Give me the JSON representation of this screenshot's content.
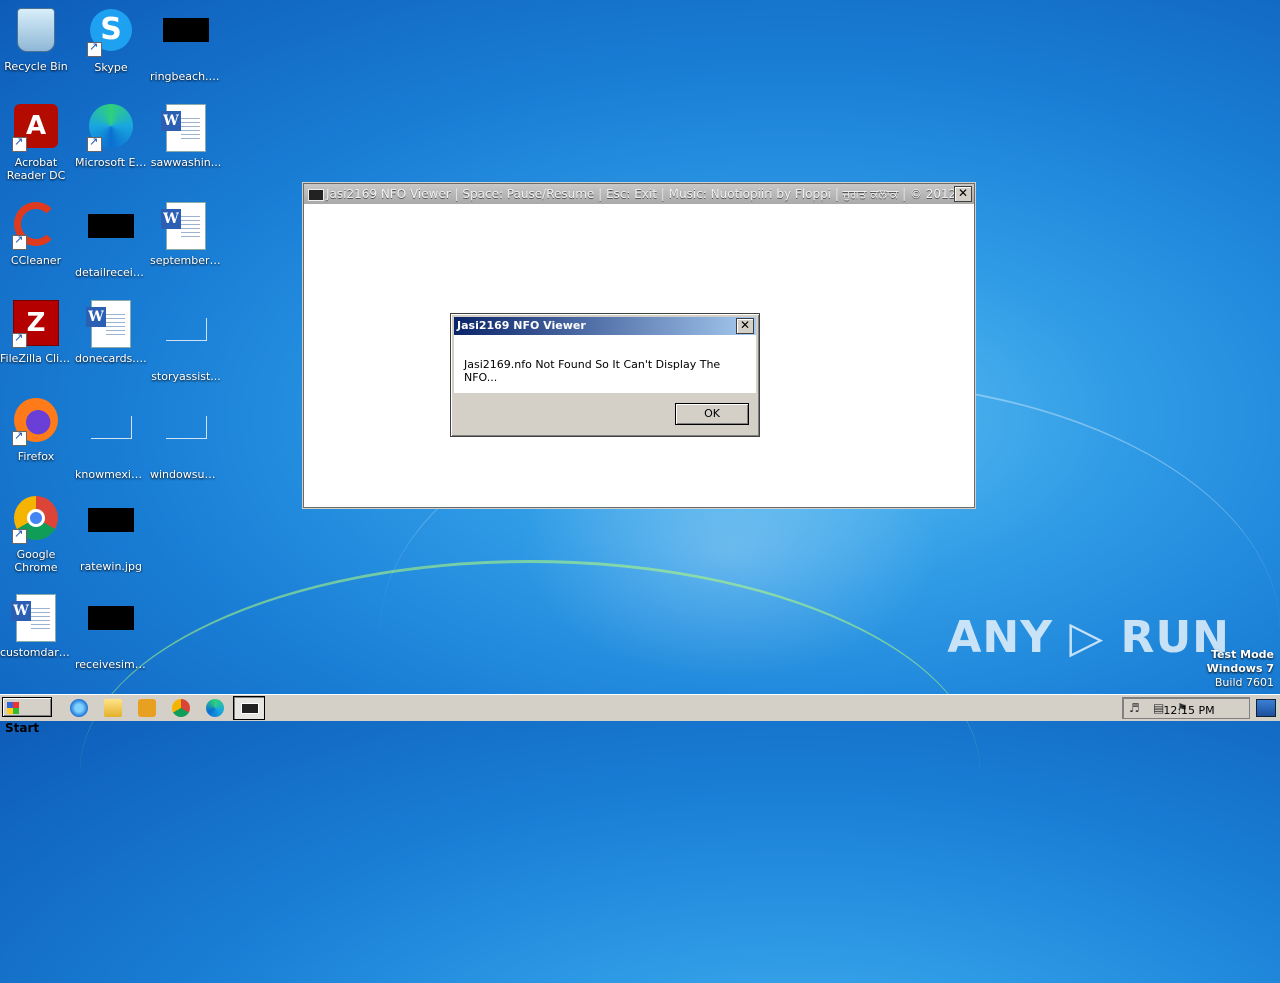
{
  "desktop": {
    "icons": [
      {
        "label": "Recycle Bin",
        "icon": "recycle-bin-icon"
      },
      {
        "label": "Skype",
        "icon": "skype-icon"
      },
      {
        "label": "ringbeach.jpg",
        "icon": "image-file-icon"
      },
      {
        "label": "Acrobat Reader DC",
        "icon": "acrobat-icon"
      },
      {
        "label": "Microsoft Edge",
        "icon": "edge-icon"
      },
      {
        "label": "sawwashin...",
        "icon": "word-doc-icon"
      },
      {
        "label": "CCleaner",
        "icon": "ccleaner-icon"
      },
      {
        "label": "detailreceiv...",
        "icon": "image-file-icon"
      },
      {
        "label": "septemberp...",
        "icon": "word-doc-icon"
      },
      {
        "label": "FileZilla Client",
        "icon": "filezilla-icon"
      },
      {
        "label": "donecards.rtf",
        "icon": "word-doc-icon"
      },
      {
        "label": "storyassist...",
        "icon": "blank-file-icon"
      },
      {
        "label": "Firefox",
        "icon": "firefox-icon"
      },
      {
        "label": "knowmexic...",
        "icon": "blank-file-icon"
      },
      {
        "label": "windowsuni...",
        "icon": "blank-file-icon"
      },
      {
        "label": "Google Chrome",
        "icon": "chrome-icon"
      },
      {
        "label": "ratewin.jpg",
        "icon": "image-file-icon"
      },
      {
        "label": "customdark.rtf",
        "icon": "word-doc-icon"
      },
      {
        "label": "receivesimil...",
        "icon": "image-file-icon"
      }
    ]
  },
  "viewer_window": {
    "title": "Jasi2169 NFO Viewer | Space: Pause/Resume | Esc: Exit | Music: Nuotiopiiri by Floppi | ਜੁਗਤ ਕਲਾਕ | © 2012",
    "close_label": "✕"
  },
  "dialog": {
    "title": "Jasi2169 NFO Viewer",
    "message": "Jasi2169.nfo Not Found So It Can't Display The NFO...",
    "ok_label": "OK",
    "close_label": "✕"
  },
  "watermark": "ANY ▷ RUN",
  "test_mode": {
    "line1": "Test Mode",
    "line2": "Windows 7",
    "line3": "Build 7601"
  },
  "taskbar": {
    "start_label": "Start",
    "clock": "12:15 PM"
  }
}
